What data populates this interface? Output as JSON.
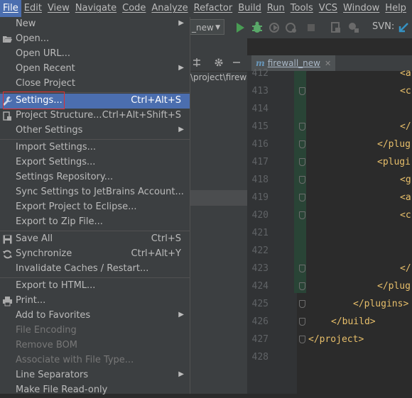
{
  "menubar": {
    "items": [
      {
        "label": "File"
      },
      {
        "label": "Edit"
      },
      {
        "label": "View"
      },
      {
        "label": "Navigate"
      },
      {
        "label": "Code"
      },
      {
        "label": "Analyze"
      },
      {
        "label": "Refactor"
      },
      {
        "label": "Build"
      },
      {
        "label": "Run"
      },
      {
        "label": "Tools"
      },
      {
        "label": "VCS"
      },
      {
        "label": "Window"
      },
      {
        "label": "Help"
      }
    ]
  },
  "toolbar": {
    "run_config": "_new",
    "svn_label": "SVN:"
  },
  "project_panel": {
    "path": "\\project\\firewa"
  },
  "editor": {
    "tab_label": "firewall_new",
    "tab_icon": "m",
    "line_numbers": [
      "412",
      "413",
      "414",
      "415",
      "416",
      "417",
      "418",
      "419",
      "420",
      "421",
      "422",
      "423",
      "424",
      "425",
      "426",
      "427",
      "428"
    ],
    "code_lines": {
      "l412": "<a",
      "l413": "<c",
      "l415": "</",
      "l416": "</plug",
      "l417": "<plugi",
      "l418": "<g",
      "l419": "<a",
      "l420": "<c",
      "l423": "</",
      "l424": "</plug",
      "l425": "</plugins>",
      "l426": "</build>",
      "l427": "</project>"
    }
  },
  "file_menu": {
    "items": [
      {
        "label": "New"
      },
      {
        "label": "Open..."
      },
      {
        "label": "Open URL..."
      },
      {
        "label": "Open Recent"
      },
      {
        "label": "Close Project"
      },
      {
        "label": "Settings...",
        "shortcut": "Ctrl+Alt+S"
      },
      {
        "label": "Project Structure...",
        "shortcut": "Ctrl+Alt+Shift+S"
      },
      {
        "label": "Other Settings"
      },
      {
        "label": "Import Settings..."
      },
      {
        "label": "Export Settings..."
      },
      {
        "label": "Settings Repository..."
      },
      {
        "label": "Sync Settings to JetBrains Account..."
      },
      {
        "label": "Export Project to Eclipse..."
      },
      {
        "label": "Export to Zip File..."
      },
      {
        "label": "Save All",
        "shortcut": "Ctrl+S"
      },
      {
        "label": "Synchronize",
        "shortcut": "Ctrl+Alt+Y"
      },
      {
        "label": "Invalidate Caches / Restart..."
      },
      {
        "label": "Export to HTML..."
      },
      {
        "label": "Print..."
      },
      {
        "label": "Add to Favorites"
      },
      {
        "label": "File Encoding"
      },
      {
        "label": "Remove BOM"
      },
      {
        "label": "Associate with File Type..."
      },
      {
        "label": "Line Separators"
      },
      {
        "label": "Make File Read-only"
      }
    ]
  },
  "colors": {
    "menu_selection": "#4b6eaf",
    "highlight_box": "#e03030",
    "run_green": "#499c54",
    "debug_green": "#59a869"
  }
}
